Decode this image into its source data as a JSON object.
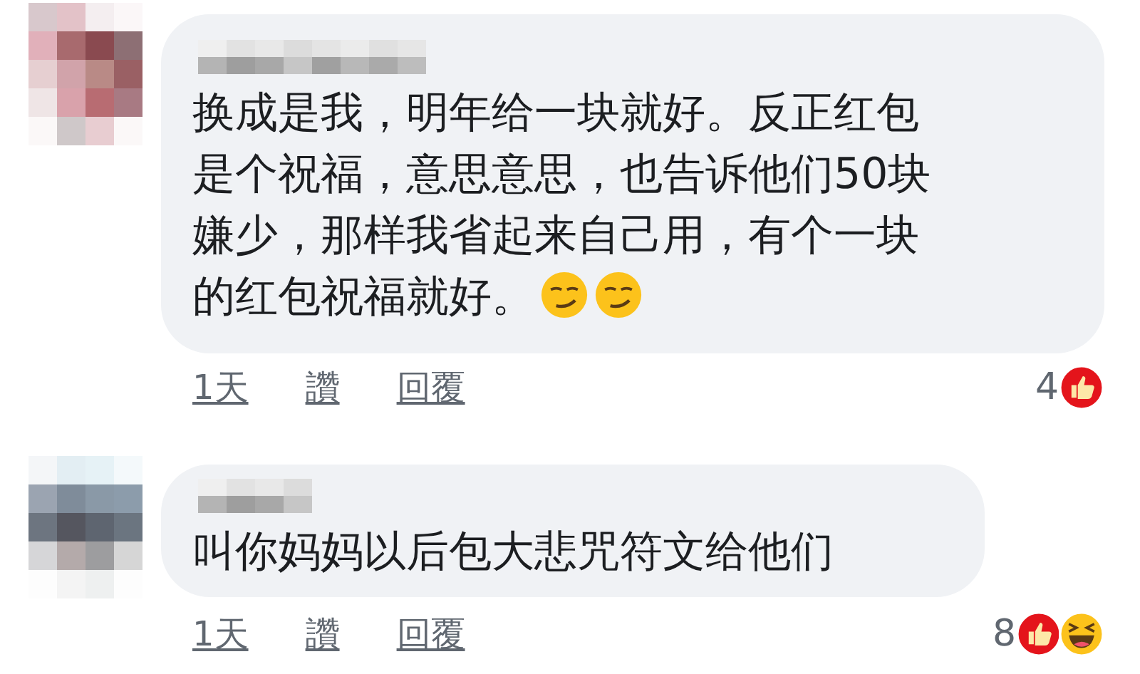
{
  "comments": [
    {
      "text": "换成是我，明年给一块就好。反正红包是个祝福，意思意思，也告诉他们50块嫌少，那样我省起来自己用，有个一块的红包祝福就好。",
      "emojis": [
        {
          "kind": "smirk"
        },
        {
          "kind": "smirk"
        }
      ],
      "actions": [
        "1天",
        "讚",
        "回覆"
      ],
      "reaction_count": "4",
      "reactions": [
        {
          "kind": "like"
        }
      ]
    },
    {
      "text": "叫你妈妈以后包大悲咒符文给他们",
      "actions": [
        "1天",
        "讚",
        "回覆"
      ],
      "reaction_count": "8",
      "reactions": [
        {
          "kind": "like"
        },
        {
          "kind": "haha"
        }
      ]
    }
  ]
}
